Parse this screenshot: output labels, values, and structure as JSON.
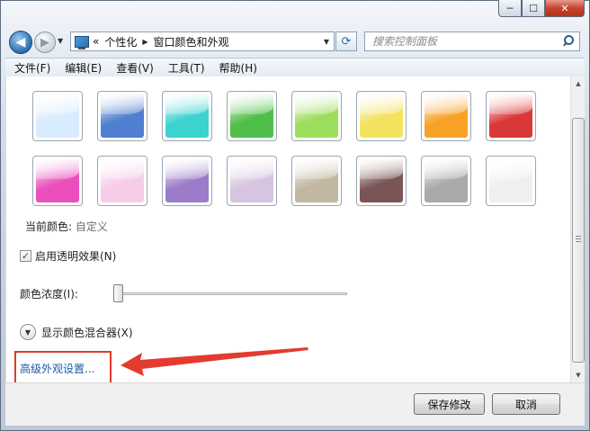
{
  "window": {
    "controls": {
      "minimize": "─",
      "maximize": "☐",
      "close": "✕"
    }
  },
  "address": {
    "overflow_marker": "«",
    "breadcrumbs": [
      "个性化",
      "窗口颜色和外观"
    ],
    "search_placeholder": "搜索控制面板"
  },
  "menu": [
    "文件(F)",
    "编辑(E)",
    "查看(V)",
    "工具(T)",
    "帮助(H)"
  ],
  "swatches": [
    {
      "name": "sky",
      "color": "#d9ebff"
    },
    {
      "name": "twilight",
      "color": "#4f7fd0"
    },
    {
      "name": "sea",
      "color": "#3cd2d0"
    },
    {
      "name": "leaf",
      "color": "#4fbf4a"
    },
    {
      "name": "lime",
      "color": "#9ddd5c"
    },
    {
      "name": "lemon",
      "color": "#f3e25e"
    },
    {
      "name": "pumpkin",
      "color": "#f7a227"
    },
    {
      "name": "ruby",
      "color": "#d93838"
    },
    {
      "name": "fuchsia",
      "color": "#ea4fbc"
    },
    {
      "name": "blush",
      "color": "#f6cce9"
    },
    {
      "name": "violet",
      "color": "#9a7cc9"
    },
    {
      "name": "lavender",
      "color": "#d7c4e0"
    },
    {
      "name": "taupe",
      "color": "#c2b7a0"
    },
    {
      "name": "chocolate",
      "color": "#7a5555"
    },
    {
      "name": "slate",
      "color": "#a9a9a9"
    },
    {
      "name": "frost",
      "color": "#efefef"
    }
  ],
  "current_color": {
    "label": "当前颜色:",
    "value": "自定义"
  },
  "transparency": {
    "label": "启用透明效果(N)",
    "checked": true,
    "check_glyph": "✓"
  },
  "intensity": {
    "label": "颜色浓度(I):",
    "value": 0
  },
  "mixer": {
    "label": "显示颜色混合器(X)",
    "chevron": "▼"
  },
  "advanced_link": "高级外观设置...",
  "scrollbar": {
    "up": "▲",
    "down": "▼"
  },
  "buttons": {
    "save": "保存修改",
    "cancel": "取消"
  }
}
